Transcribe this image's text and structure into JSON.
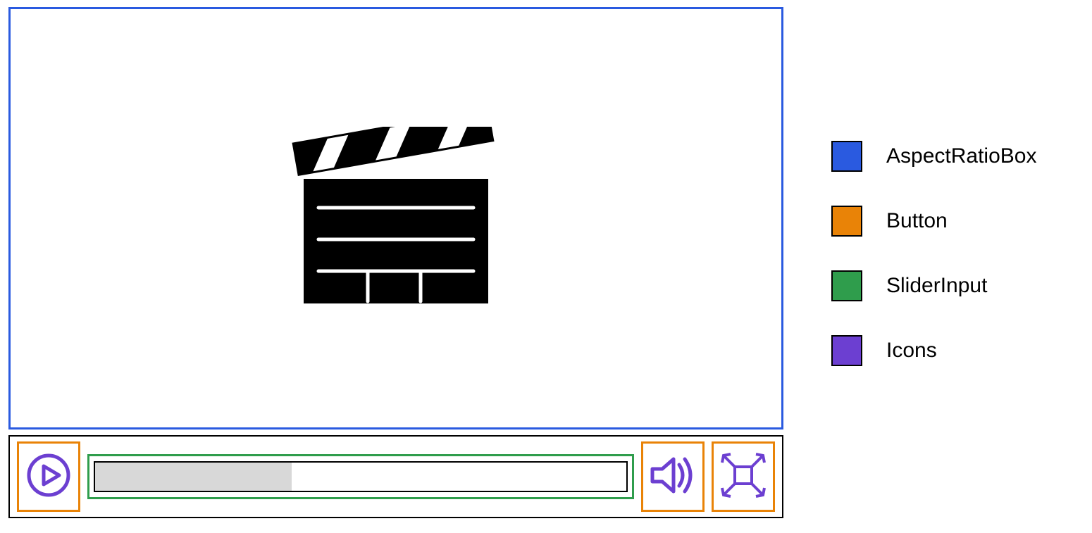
{
  "legend": {
    "items": [
      {
        "label": "AspectRatioBox",
        "color": "#2a5ae0"
      },
      {
        "label": "Button",
        "color": "#e98307"
      },
      {
        "label": "SliderInput",
        "color": "#2f9d4c"
      },
      {
        "label": "Icons",
        "color": "#6c3fd1"
      }
    ]
  },
  "player": {
    "progress_percent": 37,
    "icons": {
      "play": "play-icon",
      "volume": "volume-icon",
      "fullscreen": "fullscreen-icon",
      "clapper": "clapperboard-icon"
    }
  },
  "colors": {
    "aspect_box_border": "#2a5ae0",
    "button_border": "#e98307",
    "slider_border": "#2f9d4c",
    "icon_stroke": "#6c3fd1"
  }
}
